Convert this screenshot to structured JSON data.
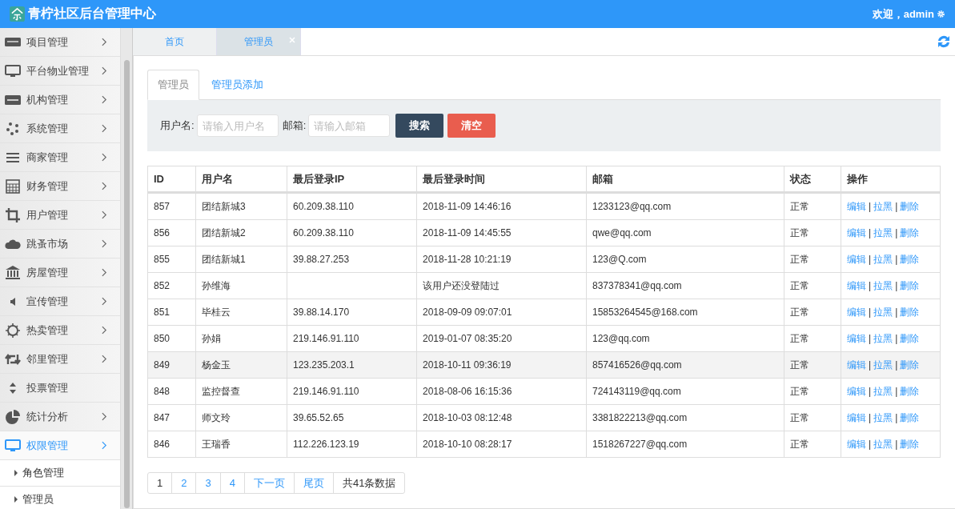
{
  "header": {
    "title": "青柠社区后台管理中心",
    "welcome": "欢迎，admin"
  },
  "sidebar": {
    "items": [
      {
        "label": "项目管理",
        "expandable": true,
        "expanded": false
      },
      {
        "label": "平台物业管理",
        "expandable": true,
        "expanded": false
      },
      {
        "label": "机构管理",
        "expandable": true,
        "expanded": false
      },
      {
        "label": "系统管理",
        "expandable": true,
        "expanded": false
      },
      {
        "label": "商家管理",
        "expandable": true,
        "expanded": false
      },
      {
        "label": "财务管理",
        "expandable": true,
        "expanded": false
      },
      {
        "label": "用户管理",
        "expandable": true,
        "expanded": false
      },
      {
        "label": "跳蚤市场",
        "expandable": true,
        "expanded": false
      },
      {
        "label": "房屋管理",
        "expandable": true,
        "expanded": false
      },
      {
        "label": "宣传管理",
        "expandable": true,
        "expanded": false
      },
      {
        "label": "热卖管理",
        "expandable": true,
        "expanded": false
      },
      {
        "label": "邻里管理",
        "expandable": true,
        "expanded": false
      },
      {
        "label": "投票管理",
        "expandable": false,
        "expanded": false
      },
      {
        "label": "统计分析",
        "expandable": true,
        "expanded": false
      },
      {
        "label": "权限管理",
        "expandable": true,
        "expanded": true,
        "children": [
          {
            "label": "角色管理"
          },
          {
            "label": "管理员"
          }
        ]
      }
    ]
  },
  "page_tabs": [
    {
      "label": "首页",
      "selected": false,
      "closable": false
    },
    {
      "label": "管理员",
      "selected": true,
      "closable": true
    }
  ],
  "sub_tabs": [
    {
      "label": "管理员",
      "selected": true
    },
    {
      "label": "管理员添加",
      "selected": false
    }
  ],
  "search": {
    "fields": [
      {
        "label": "用户名:",
        "placeholder": "请输入用户名"
      },
      {
        "label": "邮箱:",
        "placeholder": "请输入邮箱"
      }
    ],
    "buttons": [
      {
        "label": "搜索",
        "kind": "primary"
      },
      {
        "label": "清空",
        "kind": "danger"
      }
    ]
  },
  "table": {
    "columns": [
      "ID",
      "用户名",
      "最后登录IP",
      "最后登录时间",
      "邮箱",
      "状态",
      "操作"
    ],
    "action_separator": "|",
    "rows": [
      {
        "cells": [
          "857",
          "团结新城3",
          "60.209.38.110",
          "2018-11-09 14:46:16",
          "1233123@qq.com",
          "正常"
        ],
        "actions": [
          "编辑",
          "拉黑",
          "删除"
        ],
        "selected": false
      },
      {
        "cells": [
          "856",
          "团结新城2",
          "60.209.38.110",
          "2018-11-09 14:45:55",
          "qwe@qq.com",
          "正常"
        ],
        "actions": [
          "编辑",
          "拉黑",
          "删除"
        ],
        "selected": false
      },
      {
        "cells": [
          "855",
          "团结新城1",
          "39.88.27.253",
          "2018-11-28 10:21:19",
          "123@Q.com",
          "正常"
        ],
        "actions": [
          "编辑",
          "拉黑",
          "删除"
        ],
        "selected": false
      },
      {
        "cells": [
          "852",
          "孙维海",
          "",
          "该用户还没登陆过",
          "837378341@qq.com",
          "正常"
        ],
        "actions": [
          "编辑",
          "拉黑",
          "删除"
        ],
        "selected": false
      },
      {
        "cells": [
          "851",
          "毕桂云",
          "39.88.14.170",
          "2018-09-09 09:07:01",
          "15853264545@168.com",
          "正常"
        ],
        "actions": [
          "编辑",
          "拉黑",
          "删除"
        ],
        "selected": false
      },
      {
        "cells": [
          "850",
          "孙娟",
          "219.146.91.110",
          "2019-01-07 08:35:20",
          "123@qq.com",
          "正常"
        ],
        "actions": [
          "编辑",
          "拉黑",
          "删除"
        ],
        "selected": false
      },
      {
        "cells": [
          "849",
          "杨金玉",
          "123.235.203.1",
          "2018-10-11 09:36:19",
          "857416526@qq.com",
          "正常"
        ],
        "actions": [
          "编辑",
          "拉黑",
          "删除"
        ],
        "selected": true
      },
      {
        "cells": [
          "848",
          "监控督查",
          "219.146.91.110",
          "2018-08-06 16:15:36",
          "724143119@qq.com",
          "正常"
        ],
        "actions": [
          "编辑",
          "拉黑",
          "删除"
        ],
        "selected": false
      },
      {
        "cells": [
          "847",
          "师文玲",
          "39.65.52.65",
          "2018-10-03 08:12:48",
          "3381822213@qq.com",
          "正常"
        ],
        "actions": [
          "编辑",
          "拉黑",
          "删除"
        ],
        "selected": false
      },
      {
        "cells": [
          "846",
          "王瑞香",
          "112.226.123.19",
          "2018-10-10 08:28:17",
          "1518267227@qq.com",
          "正常"
        ],
        "actions": [
          "编辑",
          "拉黑",
          "删除"
        ],
        "selected": false
      }
    ]
  },
  "pagination": {
    "pages": [
      {
        "label": "1",
        "selected": true
      },
      {
        "label": "2",
        "selected": false
      },
      {
        "label": "3",
        "selected": false
      },
      {
        "label": "4",
        "selected": false
      }
    ],
    "next": "下一页",
    "last": "尾页",
    "total": "共41条数据"
  }
}
